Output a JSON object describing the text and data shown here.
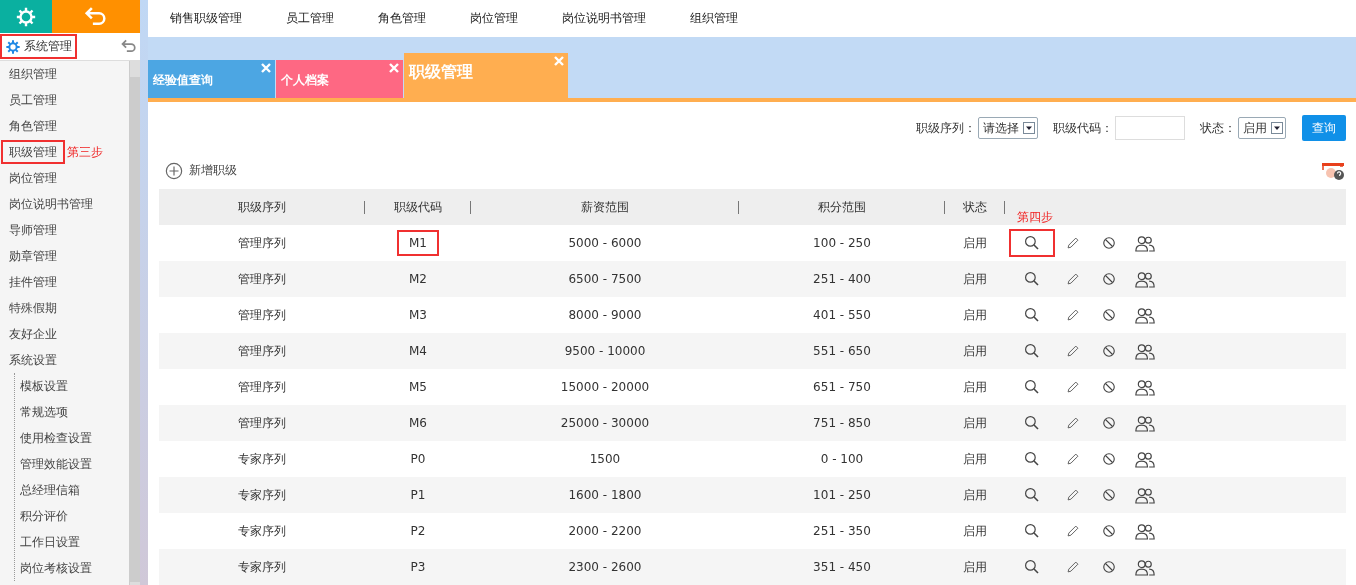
{
  "sidebar": {
    "header": {
      "label": "系统管理",
      "highlighted": true
    },
    "items": [
      {
        "label": "组织管理",
        "highlighted": false
      },
      {
        "label": "员工管理",
        "highlighted": false
      },
      {
        "label": "角色管理",
        "highlighted": false
      },
      {
        "label": "职级管理",
        "highlighted": true,
        "step_note": "第三步"
      },
      {
        "label": "岗位管理",
        "highlighted": false
      },
      {
        "label": "岗位说明书管理",
        "highlighted": false
      },
      {
        "label": "导师管理",
        "highlighted": false
      },
      {
        "label": "勋章管理",
        "highlighted": false
      },
      {
        "label": "挂件管理",
        "highlighted": false
      },
      {
        "label": "特殊假期",
        "highlighted": false
      },
      {
        "label": "友好企业",
        "highlighted": false
      },
      {
        "label": "系统设置",
        "highlighted": false,
        "children": [
          {
            "label": "模板设置"
          },
          {
            "label": "常规选项"
          },
          {
            "label": "使用检查设置"
          },
          {
            "label": "管理效能设置"
          },
          {
            "label": "总经理信箱"
          },
          {
            "label": "积分评价"
          },
          {
            "label": "工作日设置"
          },
          {
            "label": "岗位考核设置"
          }
        ]
      }
    ]
  },
  "top_nav": [
    "销售职级管理",
    "员工管理",
    "角色管理",
    "岗位管理",
    "岗位说明书管理",
    "组织管理"
  ],
  "tabs": [
    {
      "label": "经验值查询",
      "selected": false,
      "color": "#4ca6e3"
    },
    {
      "label": "个人档案",
      "selected": false,
      "color": "#fe6883"
    },
    {
      "label": "职级管理",
      "selected": true,
      "color": "#ffae50"
    }
  ],
  "filters": {
    "series_label": "职级序列：",
    "series_value": "请选择",
    "code_label": "职级代码：",
    "status_label": "状态：",
    "status_value": "启用",
    "search_button": "查询"
  },
  "add_button": "新增职级",
  "table": {
    "columns": [
      "职级序列",
      "职级代码",
      "薪资范围",
      "积分范围",
      "状态"
    ],
    "rows": [
      {
        "series": "管理序列",
        "code": "M1",
        "salary": "5000 - 6000",
        "points": "100 - 250",
        "status": "启用",
        "code_highlighted": true,
        "view_highlighted": true,
        "step_note": "第四步"
      },
      {
        "series": "管理序列",
        "code": "M2",
        "salary": "6500 - 7500",
        "points": "251 - 400",
        "status": "启用",
        "code_highlighted": false,
        "view_highlighted": false
      },
      {
        "series": "管理序列",
        "code": "M3",
        "salary": "8000 - 9000",
        "points": "401 - 550",
        "status": "启用",
        "code_highlighted": false,
        "view_highlighted": false
      },
      {
        "series": "管理序列",
        "code": "M4",
        "salary": "9500 - 10000",
        "points": "551 - 650",
        "status": "启用",
        "code_highlighted": false,
        "view_highlighted": false
      },
      {
        "series": "管理序列",
        "code": "M5",
        "salary": "15000 - 20000",
        "points": "651 - 750",
        "status": "启用",
        "code_highlighted": false,
        "view_highlighted": false
      },
      {
        "series": "管理序列",
        "code": "M6",
        "salary": "25000 - 30000",
        "points": "751 - 850",
        "status": "启用",
        "code_highlighted": false,
        "view_highlighted": false
      },
      {
        "series": "专家序列",
        "code": "P0",
        "salary": "1500",
        "points": "0 - 100",
        "status": "启用",
        "code_highlighted": false,
        "view_highlighted": false
      },
      {
        "series": "专家序列",
        "code": "P1",
        "salary": "1600 - 1800",
        "points": "101 - 250",
        "status": "启用",
        "code_highlighted": false,
        "view_highlighted": false
      },
      {
        "series": "专家序列",
        "code": "P2",
        "salary": "2000 - 2200",
        "points": "251 - 350",
        "status": "启用",
        "code_highlighted": false,
        "view_highlighted": false
      },
      {
        "series": "专家序列",
        "code": "P3",
        "salary": "2300 - 2600",
        "points": "351 - 450",
        "status": "启用",
        "code_highlighted": false,
        "view_highlighted": false
      }
    ]
  }
}
